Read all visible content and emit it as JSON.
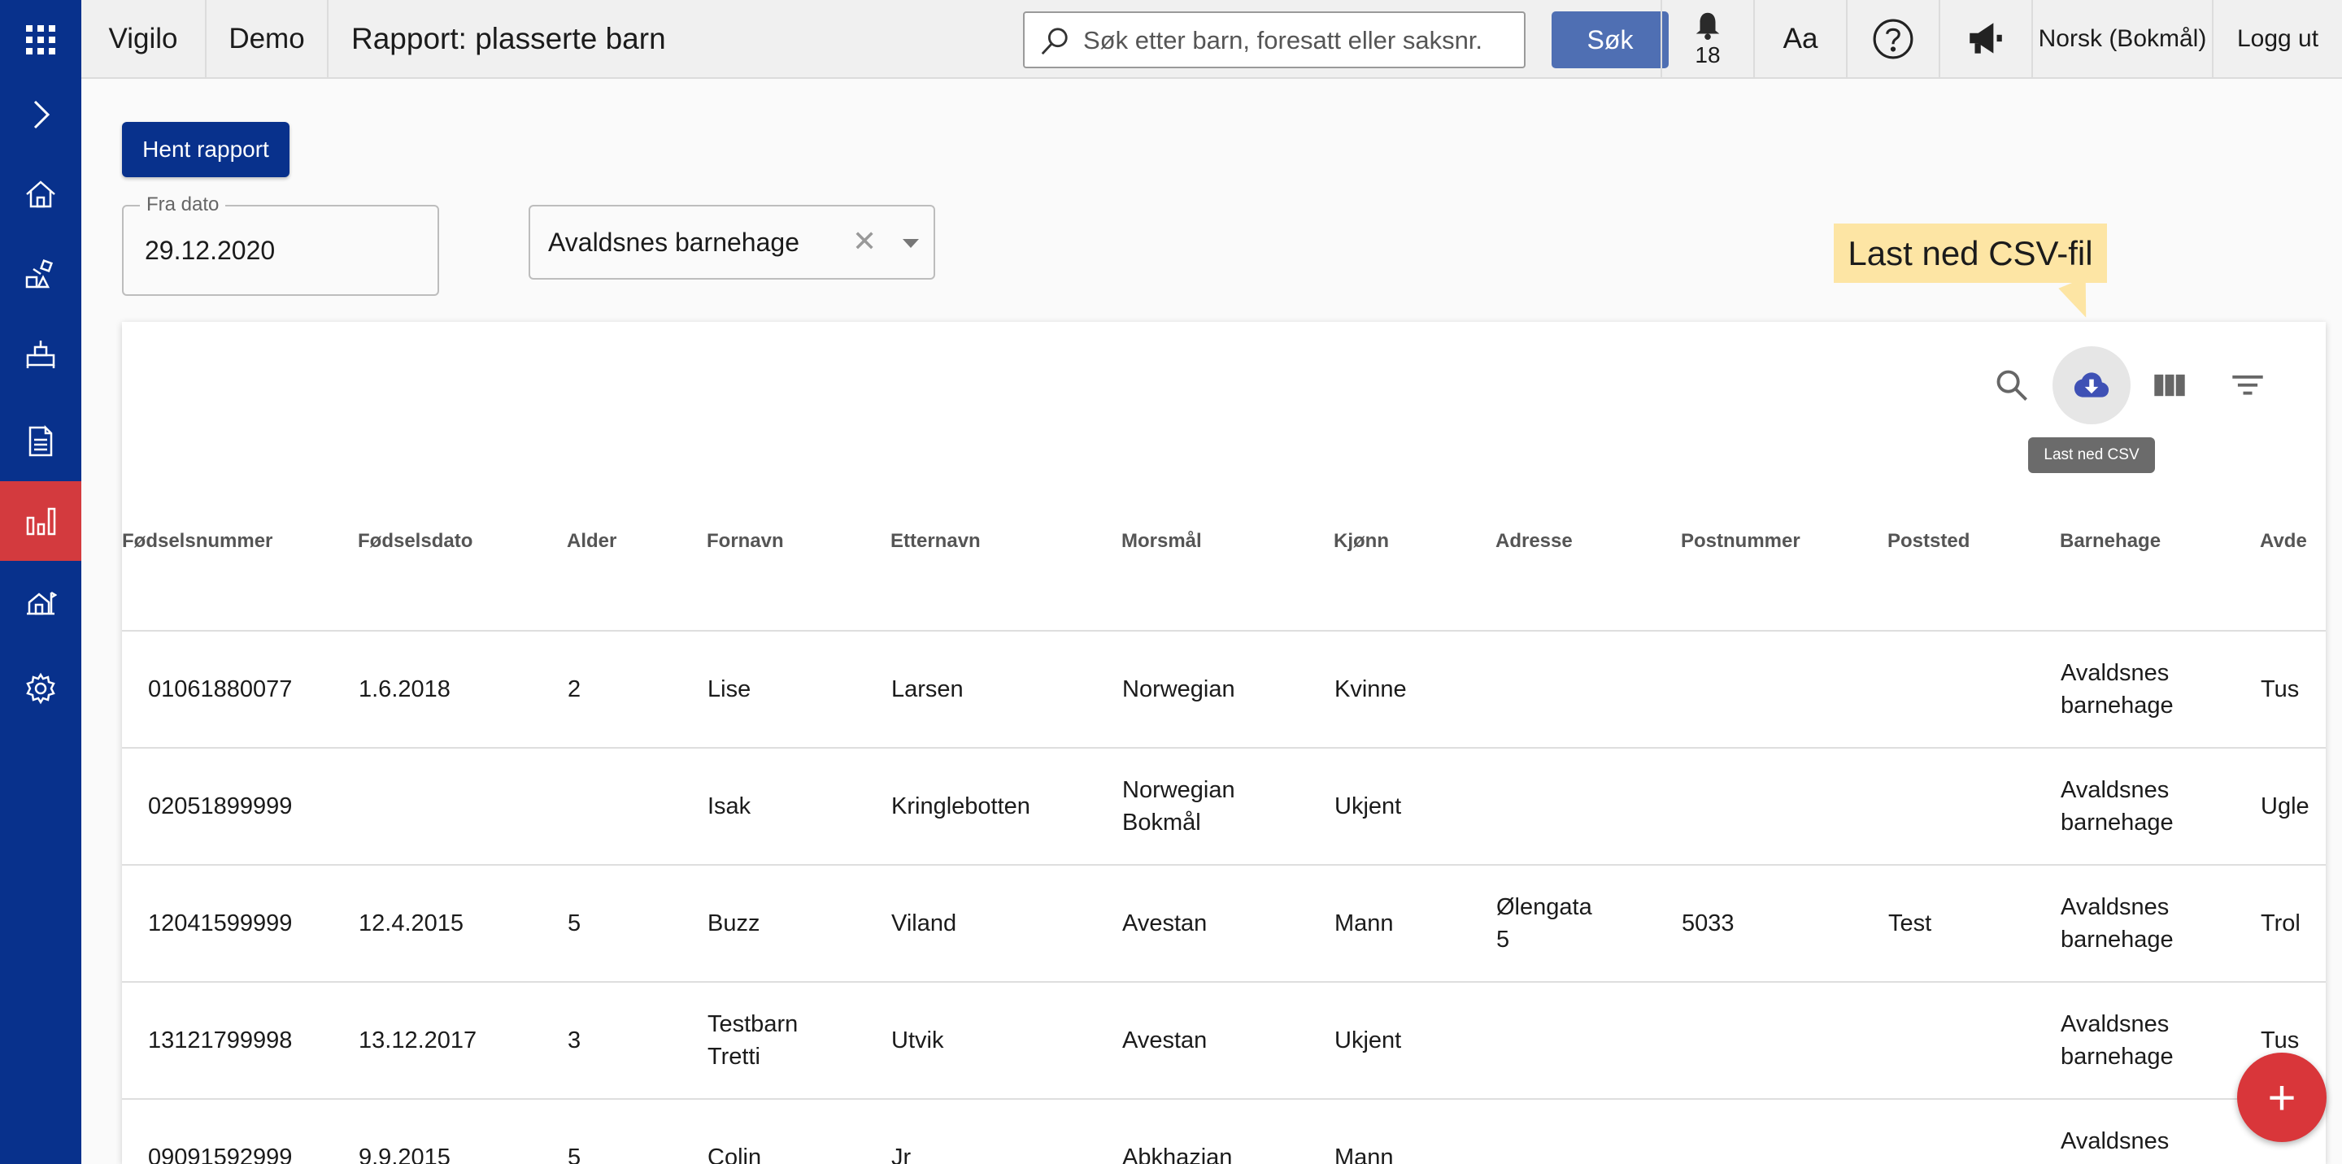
{
  "topbar": {
    "app_name": "Vigilo",
    "org": "Demo",
    "title": "Rapport: plasserte barn",
    "search_placeholder": "Søk etter barn, foresatt eller saksnr.",
    "search_button": "Søk",
    "notification_count": "18",
    "font_size_label": "Aa",
    "language": "Norsk (Bokmål)",
    "logout": "Logg ut"
  },
  "sidebar": {
    "items": [
      "apps-icon",
      "expand-icon",
      "home-icon",
      "blocks-icon",
      "bed-icon",
      "document-icon",
      "reports-icon",
      "school-icon",
      "settings-icon"
    ],
    "active": "reports-icon"
  },
  "controls": {
    "fetch_button": "Hent rapport",
    "from_date_label": "Fra dato",
    "from_date_value": "29.12.2020",
    "kindergarten_value": "Avaldsnes barnehage",
    "clear_symbol": "✕"
  },
  "callout": {
    "text": "Last ned CSV-fil"
  },
  "toolbar": {
    "tooltip": "Last ned CSV"
  },
  "table": {
    "columns": [
      "Fødselsnummer",
      "Fødselsdato",
      "Alder",
      "Fornavn",
      "Etternavn",
      "Morsmål",
      "Kjønn",
      "Adresse",
      "Postnummer",
      "Poststed",
      "Barnehage",
      "Avde"
    ],
    "rows": [
      [
        "01061880077",
        "1.6.2018",
        "2",
        "Lise",
        "Larsen",
        "Norwegian",
        "Kvinne",
        "",
        "",
        "",
        "Avaldsnes\nbarnehage",
        "Tus"
      ],
      [
        "02051899999",
        "",
        "",
        "Isak",
        "Kringlebotten",
        "Norwegian\nBokmål",
        "Ukjent",
        "",
        "",
        "",
        "Avaldsnes\nbarnehage",
        "Ugle"
      ],
      [
        "12041599999",
        "12.4.2015",
        "5",
        "Buzz",
        "Viland",
        "Avestan",
        "Mann",
        "Ølengata\n5",
        "5033",
        "Test",
        "Avaldsnes\nbarnehage",
        "Trol"
      ],
      [
        "13121799998",
        "13.12.2017",
        "3",
        "Testbarn\nTretti",
        "Utvik",
        "Avestan",
        "Ukjent",
        "",
        "",
        "",
        "Avaldsnes\nbarnehage",
        "Tus"
      ],
      [
        "09091592999",
        "9.9.2015",
        "5",
        "Colin",
        "Jr",
        "Abkhazian",
        "Mann",
        "",
        "",
        "",
        "Avaldsnes\nbarnehage",
        ""
      ]
    ]
  },
  "fab": {
    "label": "+"
  },
  "colors": {
    "primary": "#08318c",
    "accent": "#d33a3e",
    "callout": "#fde5a4",
    "search_button": "#4f6fb3"
  }
}
